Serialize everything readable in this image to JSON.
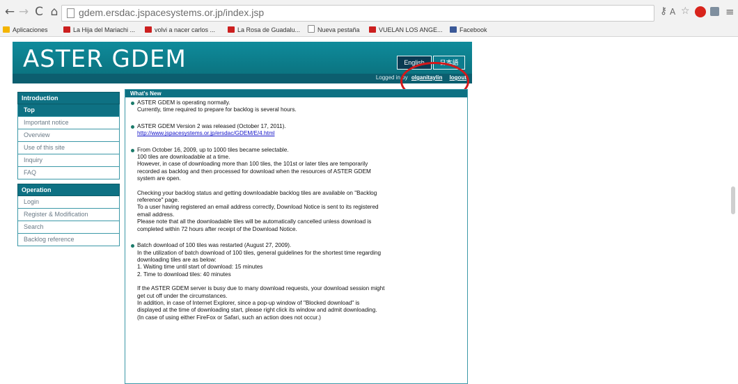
{
  "browser": {
    "url": "gdem.ersdac.jspacesystems.or.jp/index.jsp",
    "bookmarks": [
      {
        "label": "Aplicaciones",
        "icon": "apps-icon"
      },
      {
        "label": "La Hija del Mariachi ...",
        "icon": "youtube-icon"
      },
      {
        "label": "volvi a nacer carlos ...",
        "icon": "youtube-icon"
      },
      {
        "label": "La Rosa de Guadalu...",
        "icon": "youtube-icon"
      },
      {
        "label": "Nueva pestaña",
        "icon": "page-icon"
      },
      {
        "label": "VUELAN LOS ANGE...",
        "icon": "youtube-icon"
      },
      {
        "label": "Facebook",
        "icon": "facebook-icon"
      }
    ]
  },
  "header": {
    "logo": "ASTER GDEM",
    "lang_english": "English",
    "lang_japanese": "日本語",
    "logged_in_prefix": "Logged in by",
    "user": "olganitaylin",
    "logout": "logout"
  },
  "sidebar": {
    "introduction_title": "Introduction",
    "introduction_items": [
      "Top",
      "Important notice",
      "Overview",
      "Use of this site",
      "Inquiry",
      "FAQ"
    ],
    "operation_title": "Operation",
    "operation_items": [
      "Login",
      "Register & Modification",
      "Search",
      "Backlog reference"
    ]
  },
  "whats_new": {
    "title": "What's New",
    "items": [
      {
        "lines": [
          "ASTER GDEM is operating normally.",
          "Currently, time required to prepare for backlog is several hours."
        ]
      },
      {
        "lines": [
          "ASTER GDEM Version 2 was released (October 17, 2011)."
        ],
        "link": "http://www.jspacesystems.or.jp/ersdac/GDEM/E/4.html"
      },
      {
        "lines": [
          "From October 16, 2009, up to 1000 tiles became selectable.",
          "100 tiles are downloadable at a time.",
          "However, in case of downloading more than 100 tiles, the 101st or later tiles are temporarily",
          "recorded as backlog and then processed for download when the resources of ASTER GDEM",
          "system are open."
        ],
        "lines2": [
          "Checking your backlog status and getting downloadable backlog tiles are available on \"Backlog",
          "reference\" page.",
          "To a user having registered an email address correctly, Download Notice is sent to its registered",
          "email address.",
          "Please note that all the downloadable tiles will be automatically cancelled unless download is",
          "completed within 72 hours after receipt of the Download Notice."
        ]
      },
      {
        "lines": [
          "Batch download of 100 tiles was restarted (August 27, 2009).",
          "In the utilization of batch download of 100 tiles, general guidelines for the shortest time regarding",
          "downloading tiles are as below:",
          "1. Waiting time until start of download: 15 minutes",
          "2. Time to download tiles: 40 minutes"
        ],
        "lines2": [
          "If the ASTER GDEM server is busy due to many download requests, your download session might",
          "get cut off under the circumstances.",
          "In addition, in case of Internet Explorer, since a pop-up window of \"Blocked download\" is",
          "displayed at the time of downloading start, please right click its window and admit downloading.",
          "(In case of using either FireFox or Safari, such an action does not occur.)"
        ]
      }
    ]
  },
  "colors": {
    "banner": "#0f8b9b",
    "nav_header": "#0e7183",
    "annotation_circle": "#d4181a"
  }
}
